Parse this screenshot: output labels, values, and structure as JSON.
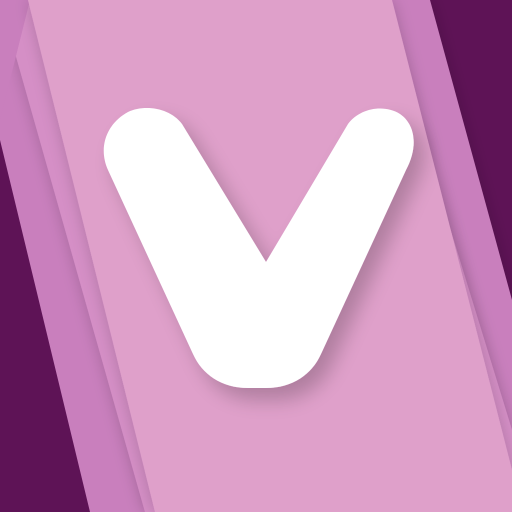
{
  "icon": {
    "name": "app-icon",
    "glyph_name": "letter-v-icon",
    "colors": {
      "dark_purple": "#5e1356",
      "mid_purple": "#c97fbd",
      "mid_purple_light": "#d58fc6",
      "pink": "#dfa0ca",
      "white": "#ffffff"
    }
  }
}
